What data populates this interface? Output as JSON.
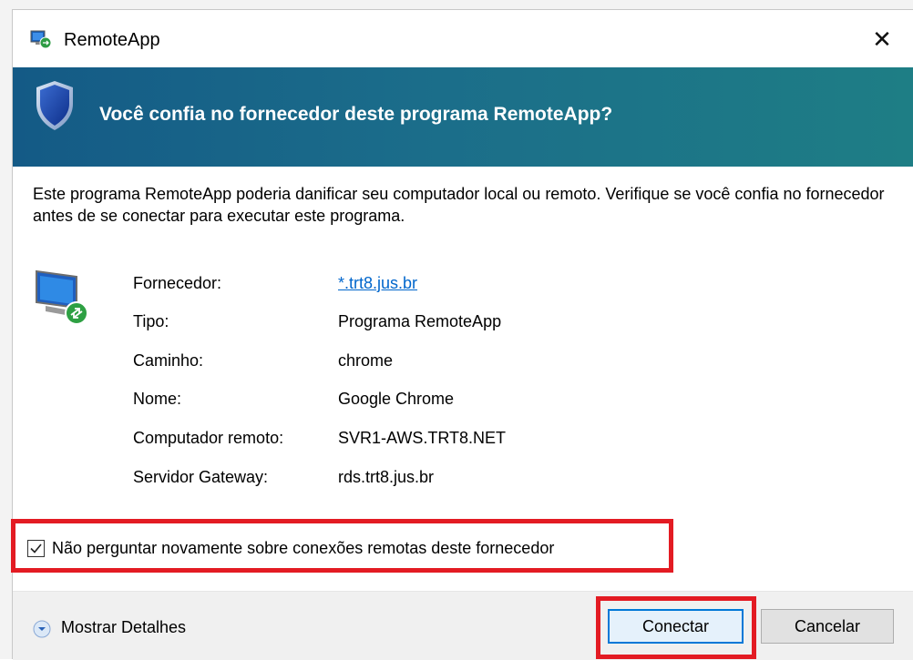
{
  "window": {
    "title": "RemoteApp",
    "close_label": "✕"
  },
  "banner": {
    "question": "Você confia no fornecedor deste programa RemoteApp?"
  },
  "description": "Este programa RemoteApp poderia danificar seu computador local ou remoto. Verifique se você confia no fornecedor antes de se conectar para executar este programa.",
  "details": [
    {
      "label": "Fornecedor:",
      "value": "*.trt8.jus.br"
    },
    {
      "label": "Tipo:",
      "value": "Programa RemoteApp"
    },
    {
      "label": "Caminho:",
      "value": "chrome"
    },
    {
      "label": "Nome:",
      "value": "Google Chrome"
    },
    {
      "label": "Computador remoto:",
      "value": "SVR1-AWS.TRT8.NET"
    },
    {
      "label": "Servidor Gateway:",
      "value": "rds.trt8.jus.br"
    }
  ],
  "dont_ask": {
    "label": "Não perguntar novamente sobre conexões remotas deste fornecedor",
    "checked": true,
    "check_mark": "✓"
  },
  "footer": {
    "show_details": "Mostrar Detalhes",
    "connect": "Conectar",
    "cancel": "Cancelar"
  },
  "colors": {
    "highlight": "#e31b23",
    "link": "#0066cc",
    "primary_border": "#0078d7"
  },
  "icons": [
    "remoteapp-icon",
    "shield-icon",
    "monitor-remote-icon",
    "checkmark-icon",
    "chevron-down-circle-icon"
  ]
}
